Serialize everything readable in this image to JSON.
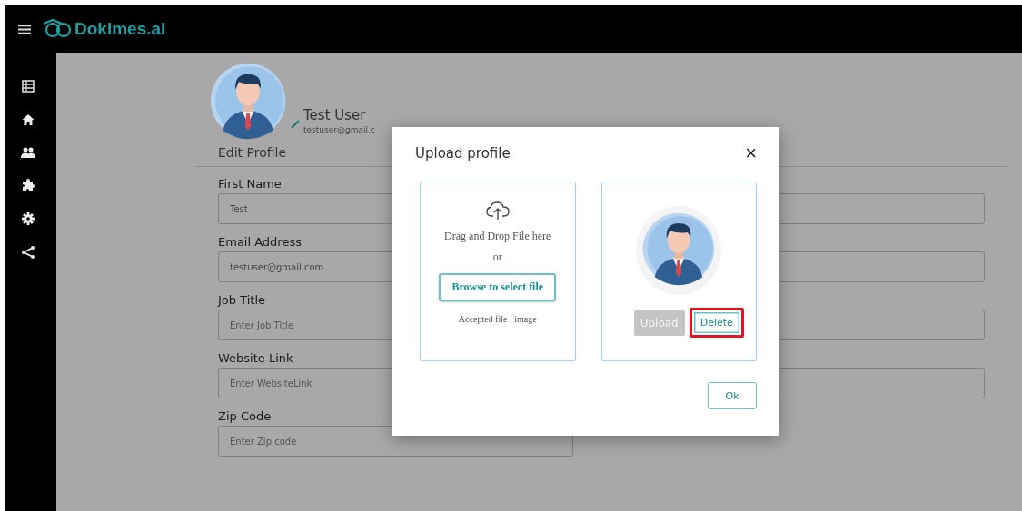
{
  "header": {
    "logo_text": "Dokimes.ai"
  },
  "sidebar": {
    "items": [
      {
        "kind": "table"
      },
      {
        "kind": "home"
      },
      {
        "kind": "people"
      },
      {
        "kind": "puzzle"
      },
      {
        "kind": "gear"
      },
      {
        "kind": "share"
      }
    ]
  },
  "profile": {
    "name": "Test User",
    "email": "testuser@gmail.c",
    "section_title": "Edit Profile"
  },
  "fields": [
    {
      "label": "First Name",
      "value": "Test"
    },
    {
      "label": "Email Address",
      "value": "testuser@gmail.com"
    },
    {
      "label": "Job Title",
      "placeholder": "Enter Job Title"
    },
    {
      "label": "Website Link",
      "placeholder": "Enter WebsiteLink"
    },
    {
      "label": "Zip Code",
      "placeholder": "Enter Zip code"
    }
  ],
  "covered_fields": [
    {
      "kind": "input"
    },
    {
      "kind": "input"
    },
    {
      "kind": "input"
    },
    {
      "kind": "input"
    }
  ],
  "dialog": {
    "title": "Upload profile",
    "close": "×",
    "dropzone": {
      "text": "Drag and Drop File here",
      "or": "or",
      "browse": "Browse to select file",
      "accepted": "Accepted file : image"
    },
    "upload_button": {
      "label": "Upload",
      "disabled": true
    },
    "delete_button": {
      "label": "Delete",
      "highlighted": true
    },
    "ok_button": "Ok"
  }
}
